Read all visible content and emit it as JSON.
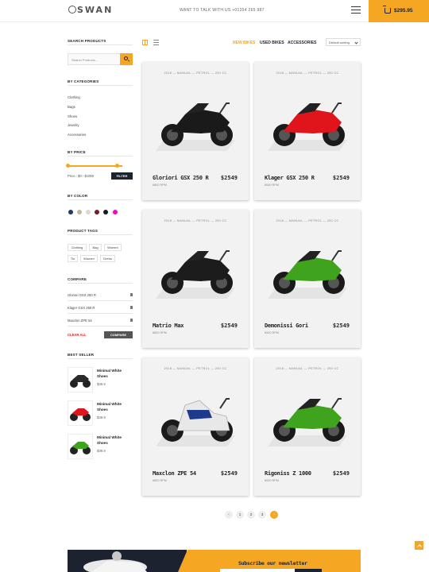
{
  "header": {
    "logo": "SWAN",
    "phone": "WANT TO TALK WITH US +01254 265 987",
    "cart_amount": "$295.95"
  },
  "sidebar": {
    "search_title": "SEARCH PRODUCTS",
    "search_placeholder": "Search Products...",
    "categories_title": "BY CATEGORIES",
    "categories": [
      "Clothing",
      "Bags",
      "Shoes",
      "Jewelry",
      "Accessories"
    ],
    "price_title": "BY PRICE",
    "price_label": "Price : $0 - $1000",
    "filter_label": "FILTER",
    "price_range": [
      0.0,
      0.9
    ],
    "color_title": "BY COLOR",
    "colors": [
      "#1d3a6b",
      "#c5b69a",
      "#d9d9d9",
      "#7a1b2a",
      "#1a1a1a",
      "#ff00cc"
    ],
    "tags_title": "PRODUCT TAGS",
    "tags": [
      "Clothing",
      "Bag",
      "Women",
      "Tie",
      "Women",
      "Dress"
    ],
    "compare_title": "COMPARE",
    "compare_items": [
      "Gloriori GSX 250 R",
      "Klager GSX 250 R",
      "Maxclon ZPE 54"
    ],
    "clear_all": "CLEAR ALL",
    "compare_button": "COMPARE",
    "bestseller_title": "BEST SELLER",
    "bestsellers": [
      {
        "name": "Minimal White Shoes",
        "price": "$39.9"
      },
      {
        "name": "Minimal White Shoes",
        "price": "$39.9"
      },
      {
        "name": "Minimal White Shoes",
        "price": "$39.9"
      }
    ]
  },
  "toolbar": {
    "tabs": [
      "NEW BIKES",
      "USED BIKES",
      "ACCESSORIES"
    ],
    "sort": "Default sorting"
  },
  "spec_line": "2018  —  MANUAL  —  PETROL  —  250 CC",
  "products": [
    {
      "name": "Gloriori GSX 250 R",
      "price": "$2549",
      "rpm": "6800 RPM",
      "color": "#1a1a1a"
    },
    {
      "name": "Klager GSX 250 R",
      "price": "$2549",
      "rpm": "8000 RPM",
      "color": "#e0141b"
    },
    {
      "name": "Matrio Max",
      "price": "$2549",
      "rpm": "6800 RPM",
      "color": "#1c1c1c"
    },
    {
      "name": "Demonissi Gori",
      "price": "$2549",
      "rpm": "6900 RPM",
      "color": "#3fa31d"
    },
    {
      "name": "Maxclon ZPE 54",
      "price": "$2549",
      "rpm": "6800 RPM",
      "color": "#e8e8e8"
    },
    {
      "name": "Rigoniss Z 1000",
      "price": "$2549",
      "rpm": "8000 RPM",
      "color": "#3fa31d"
    }
  ],
  "pagination": [
    "‹",
    "1",
    "2",
    "3",
    "›"
  ],
  "newsletter": {
    "title": "Subscribe our newsletter"
  },
  "colors": {
    "accent": "#f5a623",
    "dark": "#1d2231"
  }
}
